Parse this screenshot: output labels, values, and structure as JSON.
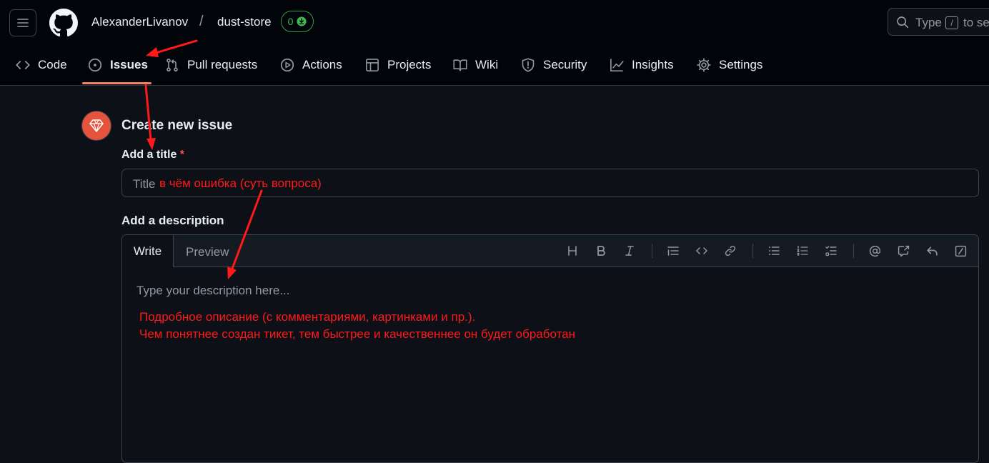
{
  "header": {
    "owner": "AlexanderLivanov",
    "separator": "/",
    "repo": "dust-store",
    "repo_counter": "0",
    "search": {
      "placeholder_start": "Type",
      "shortcut": "/",
      "placeholder_end": "to se"
    }
  },
  "nav": {
    "items": [
      {
        "label": "Code",
        "icon": "code-icon"
      },
      {
        "label": "Issues",
        "icon": "issue-opened-icon",
        "active": true
      },
      {
        "label": "Pull requests",
        "icon": "git-pull-request-icon"
      },
      {
        "label": "Actions",
        "icon": "play-icon"
      },
      {
        "label": "Projects",
        "icon": "table-icon"
      },
      {
        "label": "Wiki",
        "icon": "book-icon"
      },
      {
        "label": "Security",
        "icon": "shield-icon"
      },
      {
        "label": "Insights",
        "icon": "graph-icon"
      },
      {
        "label": "Settings",
        "icon": "gear-icon"
      }
    ]
  },
  "form": {
    "page_title": "Create new issue",
    "title_label": "Add a title",
    "required_mark": "*",
    "title_placeholder": "Title",
    "description_label": "Add a description",
    "tabs": {
      "write": "Write",
      "preview": "Preview"
    },
    "toolbar": [
      "heading-icon",
      "bold-icon",
      "italic-icon",
      "quote-icon",
      "code-icon",
      "link-icon",
      "unordered-list-icon",
      "ordered-list-icon",
      "task-list-icon",
      "mention-icon",
      "cross-reference-icon",
      "reply-icon",
      "slash-command-icon"
    ],
    "description_placeholder": "Type your description here..."
  },
  "annotations": {
    "title_note": "в чём ошибка (суть вопроса)",
    "desc_note_1": "Подробное описание (с комментариями, картинками и пр.).",
    "desc_note_2": "Чем понятнее создан тикет, тем быстрее и качественнее он будет обработан",
    "color": "#ff1a1a"
  },
  "colors": {
    "background": "#0d1117",
    "header_bg": "#010409",
    "active_tab_underline": "#f78166",
    "avatar": "#e5533d",
    "required": "#f85149",
    "counter": "#3fb950"
  }
}
